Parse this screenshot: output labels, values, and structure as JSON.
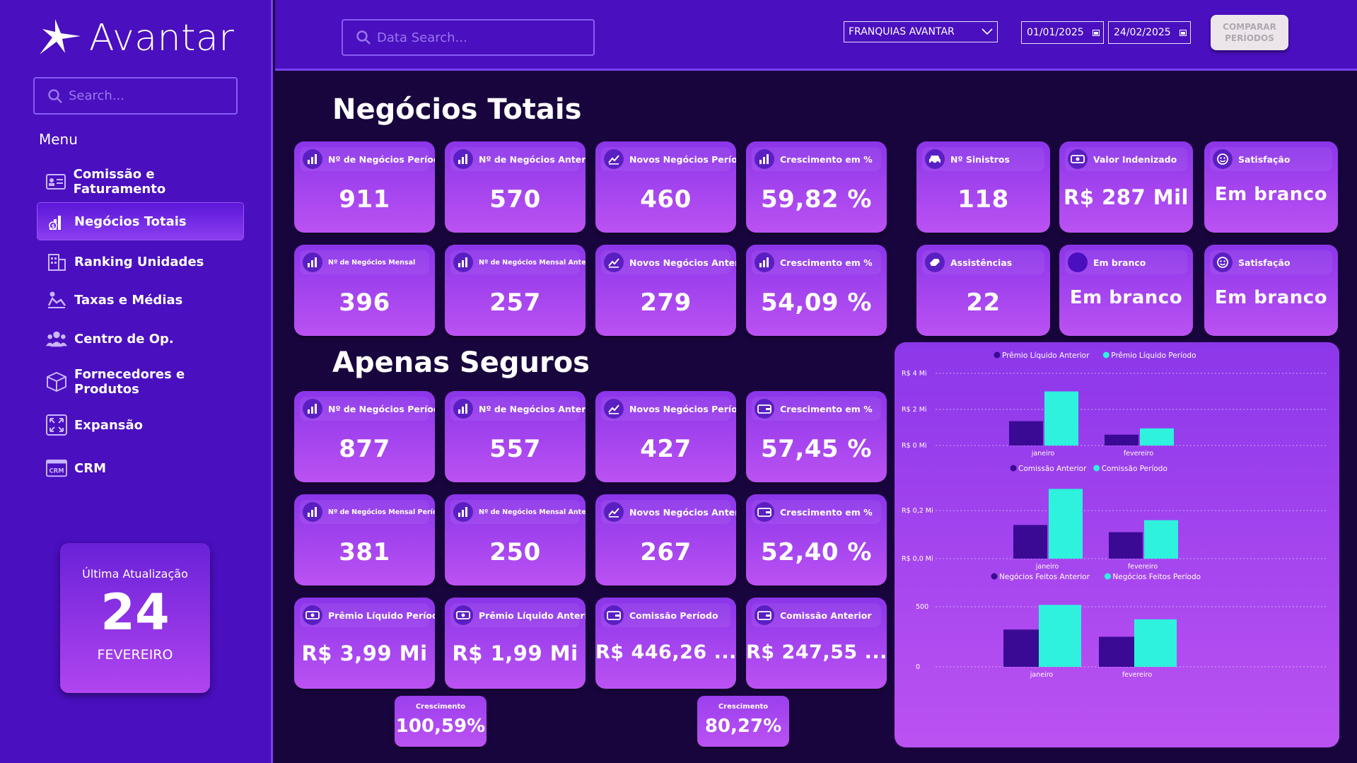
{
  "sidebar": {
    "logo_text": "Avantar",
    "search_placeholder": "Search...",
    "menu_title": "Menu",
    "items": [
      {
        "label": "Comissão e Faturamento",
        "icon": "id-card-icon"
      },
      {
        "label": "Negócios Totais",
        "icon": "growth-chart-icon",
        "active": true
      },
      {
        "label": "Ranking Unidades",
        "icon": "building-icon"
      },
      {
        "label": "Taxas e Médias",
        "icon": "percent-user-icon"
      },
      {
        "label": "Centro de Op.",
        "icon": "team-icon"
      },
      {
        "label": "Fornecedores e Produtos",
        "icon": "box-icon"
      },
      {
        "label": "Expansão",
        "icon": "expand-icon"
      },
      {
        "label": "CRM",
        "icon": "crm-icon"
      }
    ],
    "update": {
      "label": "Última Atualização",
      "day": "24",
      "month": "FEVEREIRO"
    }
  },
  "topbar": {
    "search_placeholder": "Data Search...",
    "franchise": "FRANQUIAS AVANTAR",
    "date_start": "01/01/2025",
    "date_end": "24/02/2025",
    "compare_label_1": "COMPARAR",
    "compare_label_2": "PERÍODOS"
  },
  "sections": {
    "total": "Negócios Totais",
    "insurance": "Apenas Seguros"
  },
  "kpis": {
    "total": [
      {
        "label": "Nº de Negócios Período",
        "value": "911"
      },
      {
        "label": "Nº de Negócios Anterior",
        "value": "570"
      },
      {
        "label": "Novos Negócios Período",
        "value": "460"
      },
      {
        "label": "Crescimento em %",
        "value": "59,82 %"
      },
      {
        "label": "Nº de Negócios Mensal",
        "value": "396"
      },
      {
        "label": "Nº de Negócios Mensal Anterior",
        "value": "257"
      },
      {
        "label": "Novos Negócios Anterior",
        "value": "279"
      },
      {
        "label": "Crescimento em %",
        "value": "54,09  %"
      }
    ],
    "claims": [
      {
        "label": "Nº Sinistros",
        "value": "118"
      },
      {
        "label": "Valor Indenizado",
        "value": "R$ 287 Mil"
      },
      {
        "label": "Satisfação",
        "value": "Em branco"
      },
      {
        "label": "Assistências",
        "value": "22"
      },
      {
        "label": "Em branco",
        "value": "Em branco"
      },
      {
        "label": "Satisfação",
        "value": "Em branco"
      }
    ],
    "insurance": [
      {
        "label": "Nº de Negócios Período",
        "value": "877"
      },
      {
        "label": "Nº de Negócios Anterior",
        "value": "557"
      },
      {
        "label": "Novos Negócios Período",
        "value": "427"
      },
      {
        "label": "Crescimento em %",
        "value": "57,45 %"
      },
      {
        "label": "Nº de Negócios Mensal Período",
        "value": "381"
      },
      {
        "label": "Nº de Negócios Mensal Anterior",
        "value": "250"
      },
      {
        "label": "Novos Negócios Anterior",
        "value": "267"
      },
      {
        "label": "Crescimento em %",
        "value": "52,40 %"
      },
      {
        "label": "Prêmio Líquido Período",
        "value": "R$ 3,99 Mi"
      },
      {
        "label": "Prêmio Líquido Anterior",
        "value": "R$ 1,99 Mi"
      },
      {
        "label": "Comissão Período",
        "value": "R$ 446,26 ..."
      },
      {
        "label": "Comissão Anterior",
        "value": "R$ 247,55 ..."
      }
    ],
    "growth": [
      {
        "label": "Crescimento",
        "value": "100,59%"
      },
      {
        "label": "Crescimento",
        "value": "80,27%"
      }
    ]
  },
  "colors": {
    "previous": "#3a0a94",
    "current": "#2ef2dd",
    "accent": "#4a0fbf"
  },
  "chart_data": [
    {
      "type": "bar",
      "categories": [
        "janeiro",
        "fevereiro"
      ],
      "series": [
        {
          "name": "Prêmio Líquido Anterior",
          "values": [
            1.35,
            0.6
          ]
        },
        {
          "name": "Prêmio Líquido Período",
          "values": [
            3.0,
            0.95
          ]
        }
      ],
      "yticks": [
        "R$ 4 Mi",
        "R$ 2 Mi",
        "R$ 0 Mi"
      ],
      "ylim": [
        0,
        4
      ],
      "grid": true,
      "legend": "top-center"
    },
    {
      "type": "bar",
      "categories": [
        "janeiro",
        "fevereiro"
      ],
      "series": [
        {
          "name": "Comissão Anterior",
          "values": [
            0.14,
            0.11
          ]
        },
        {
          "name": "Comissão Período",
          "values": [
            0.29,
            0.16
          ]
        }
      ],
      "yticks": [
        "R$ 0,2 Mi",
        "R$ 0,0 Mi"
      ],
      "ylim": [
        0,
        0.2
      ],
      "grid": true,
      "legend": "top-center"
    },
    {
      "type": "bar",
      "categories": [
        "janeiro",
        "fevereiro"
      ],
      "series": [
        {
          "name": "Negócios Feitos Anterior",
          "values": [
            310,
            250
          ]
        },
        {
          "name": "Negócios Feitos Período",
          "values": [
            515,
            395
          ]
        }
      ],
      "yticks": [
        "500",
        "0"
      ],
      "ylim": [
        0,
        500
      ],
      "grid": true,
      "legend": "top-center"
    }
  ]
}
